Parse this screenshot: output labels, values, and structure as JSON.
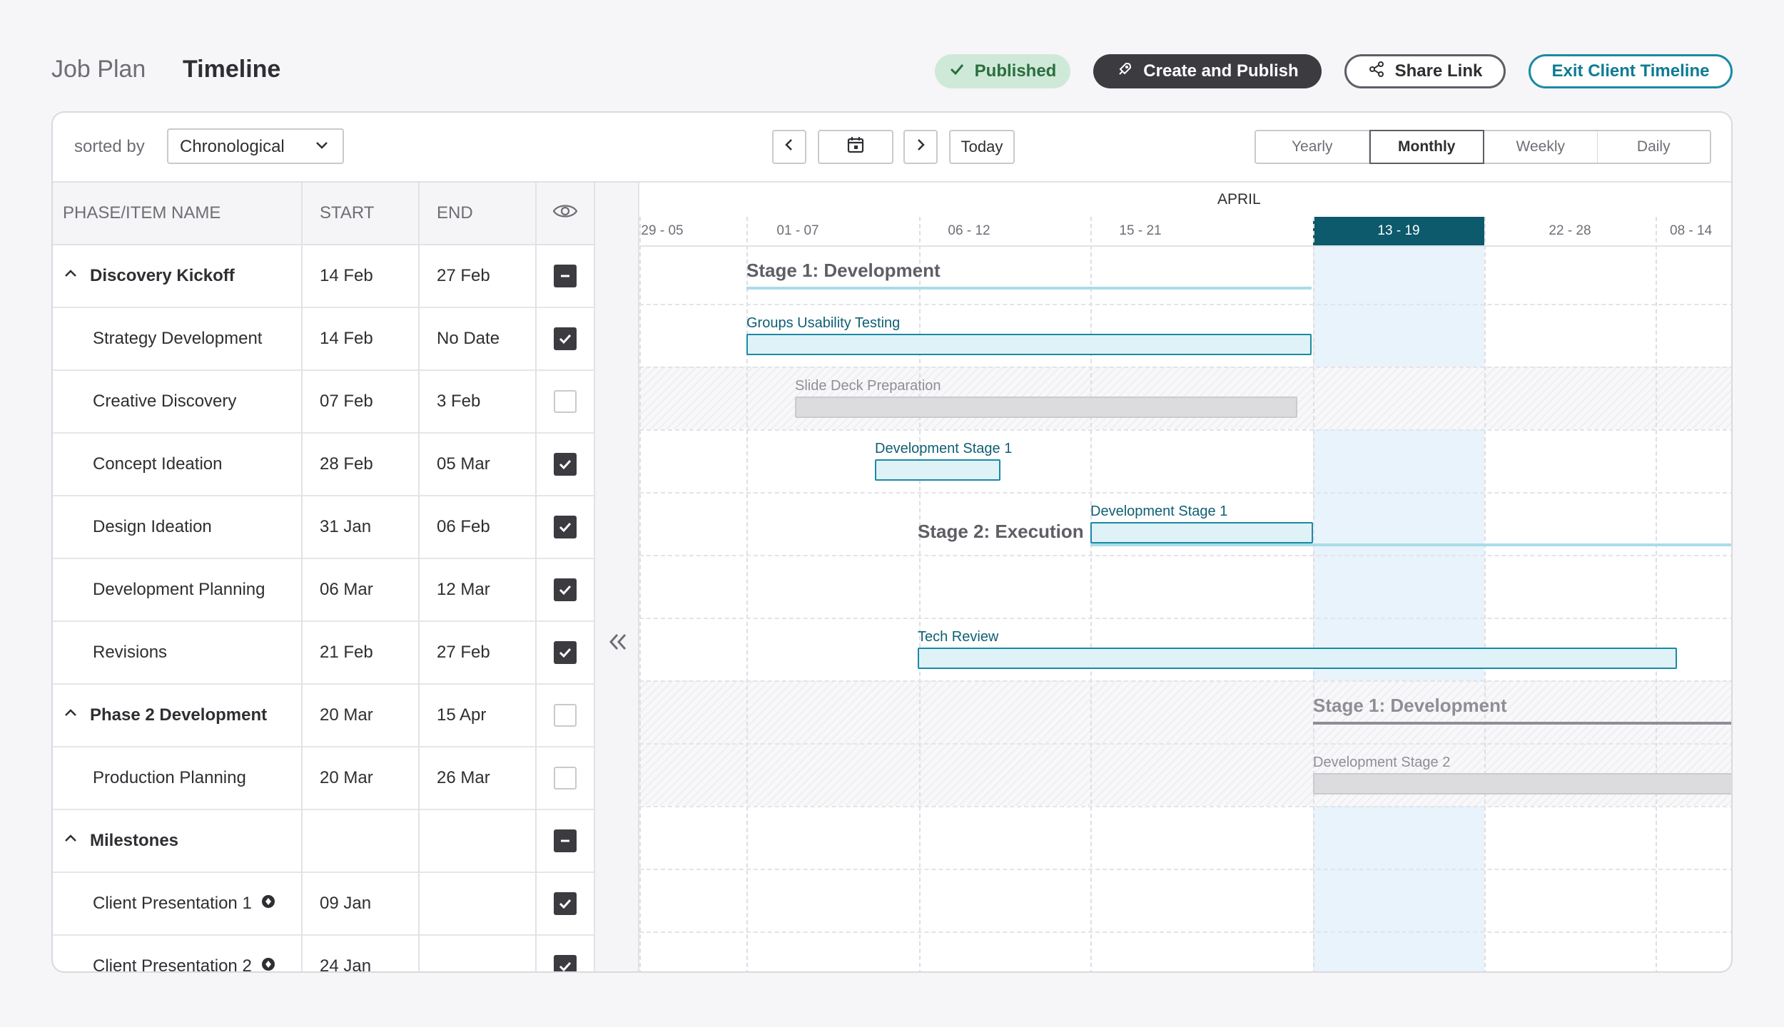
{
  "header": {
    "title_muted": "Job Plan",
    "title_main": "Timeline",
    "published_label": "Published",
    "create_publish_label": "Create and Publish",
    "share_link_label": "Share Link",
    "exit_label": "Exit Client Timeline"
  },
  "toolbar": {
    "sorted_by_label": "sorted by",
    "sort_value": "Chronological",
    "today_label": "Today",
    "views": [
      "Yearly",
      "Monthly",
      "Weekly",
      "Daily"
    ],
    "active_view": "Monthly"
  },
  "table": {
    "columns": [
      "PHASE/ITEM NAME",
      "START",
      "END"
    ],
    "rows": [
      {
        "name": "Discovery Kickoff",
        "start": "14 Feb",
        "end": "27 Feb",
        "group": true,
        "check": "indeterminate"
      },
      {
        "name": "Strategy Development",
        "start": "14 Feb",
        "end": "No Date",
        "group": false,
        "check": "on"
      },
      {
        "name": "Creative Discovery",
        "start": "07 Feb",
        "end": "3 Feb",
        "group": false,
        "check": "off"
      },
      {
        "name": "Concept Ideation",
        "start": "28 Feb",
        "end": "05 Mar",
        "group": false,
        "check": "on"
      },
      {
        "name": "Design Ideation",
        "start": "31 Jan",
        "end": "06 Feb",
        "group": false,
        "check": "on"
      },
      {
        "name": "Development Planning",
        "start": "06 Mar",
        "end": "12 Mar",
        "group": false,
        "check": "on"
      },
      {
        "name": "Revisions",
        "start": "21 Feb",
        "end": "27 Feb",
        "group": false,
        "check": "on"
      },
      {
        "name": "Phase 2 Development",
        "start": "20 Mar",
        "end": "15 Apr",
        "group": true,
        "check": "off"
      },
      {
        "name": "Production Planning",
        "start": "20 Mar",
        "end": "26 Mar",
        "group": false,
        "check": "off"
      },
      {
        "name": "Milestones",
        "start": "",
        "end": "",
        "group": true,
        "check": "indeterminate"
      },
      {
        "name": "Client Presentation 1",
        "start": "09 Jan",
        "end": "",
        "group": false,
        "check": "on",
        "milestone": true
      },
      {
        "name": "Client Presentation 2",
        "start": "24 Jan",
        "end": "",
        "group": false,
        "check": "on",
        "milestone": true
      }
    ]
  },
  "timeline": {
    "month": "APRIL",
    "weeks": [
      "29 - 05",
      "01 - 07",
      "06 - 12",
      "15 - 21",
      "13 - 19",
      "22 - 28",
      "08 - 14"
    ],
    "current_week": "13 - 19",
    "items": {
      "stage1_dev": "Stage 1: Development",
      "groups_usability": "Groups Usability Testing",
      "slide_deck": "Slide Deck Preparation",
      "dev_stage1_a": "Development Stage 1",
      "dev_stage1_b": "Development Stage 1",
      "stage2_exec": "Stage 2: Execution",
      "tech_review": "Tech Review",
      "stage1_dev_b": "Stage 1: Development",
      "dev_stage2": "Development Stage 2"
    }
  },
  "colors": {
    "accent": "#1a8aa3",
    "current_week": "#0c5a6b",
    "published_bg": "#cfe9d8",
    "dark_button": "#3b3b40"
  }
}
